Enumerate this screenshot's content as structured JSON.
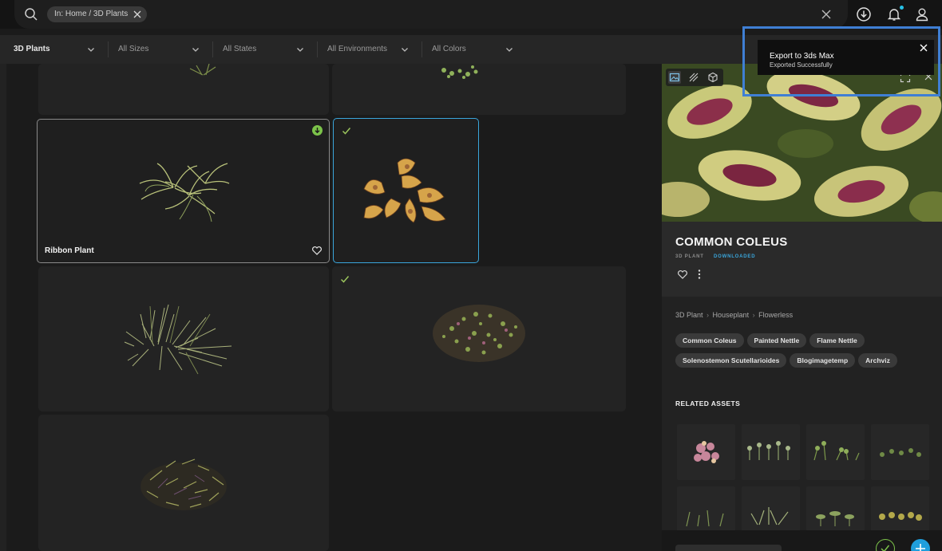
{
  "search": {
    "chip_label": "In: Home / 3D Plants"
  },
  "filters": [
    {
      "label": "3D Plants"
    },
    {
      "label": "All Sizes"
    },
    {
      "label": "All States"
    },
    {
      "label": "All Environments"
    },
    {
      "label": "All Colors"
    }
  ],
  "grid": {
    "cards": [
      {
        "title": ""
      },
      {
        "title": ""
      },
      {
        "title": "Ribbon Plant",
        "status": "downloading"
      },
      {
        "title": "",
        "status": "downloaded"
      },
      {
        "title": ""
      },
      {
        "title": "",
        "status": "downloaded"
      },
      {
        "title": ""
      }
    ]
  },
  "asset": {
    "title": "COMMON COLEUS",
    "type": "3D PLANT",
    "status": "DOWNLOADED",
    "breadcrumb": [
      "3D Plant",
      "Houseplant",
      "Flowerless"
    ],
    "tags": [
      "Common Coleus",
      "Painted Nettle",
      "Flame Nettle",
      "Solenostemon Scutellarioides",
      "Blogimagetemp",
      "Archviz"
    ],
    "related_heading": "RELATED ASSETS"
  },
  "toast": {
    "title": "Export to 3ds Max",
    "subtitle": "Exported Successfully"
  },
  "colors": {
    "accent_blue": "#3aa6dc",
    "accent_green": "#7cc34a",
    "highlight": "#3f7fd4"
  }
}
